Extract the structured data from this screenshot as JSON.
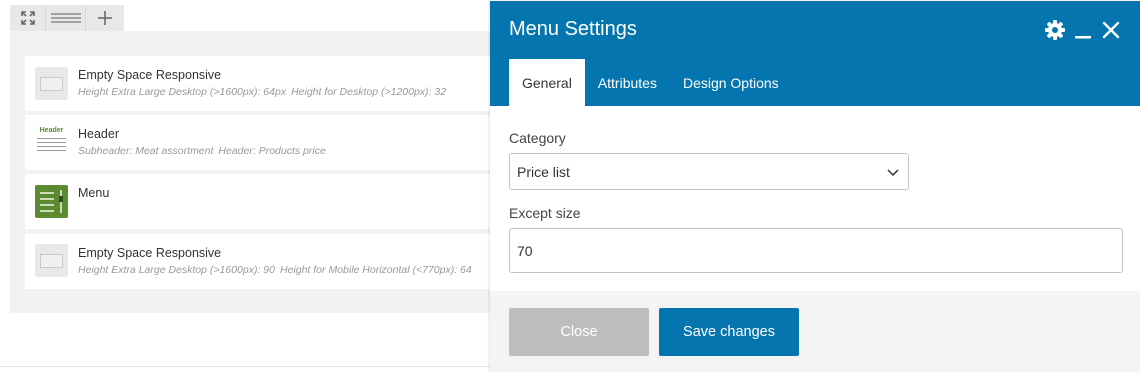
{
  "toolbar": {
    "icons": [
      "fullscreen-icon",
      "menu-lines-icon",
      "plus-icon"
    ]
  },
  "elements": [
    {
      "title": "Empty Space Responsive",
      "icon": "empty-space-icon",
      "params": [
        "Height Extra Large Desktop (>1600px): 64px",
        "Height for Desktop (>1200px): 32"
      ]
    },
    {
      "title": "Header",
      "icon": "header-icon",
      "icon_text": "Header",
      "params": [
        "Subheader: Meat assortment",
        "Header: Products price"
      ]
    },
    {
      "title": "Menu",
      "icon": "menu-element-icon",
      "params": []
    },
    {
      "title": "Empty Space Responsive",
      "icon": "empty-space-icon",
      "params": [
        "Height Extra Large Desktop (>1600px): 90",
        "Height for Mobile Horizontal (<770px): 64"
      ]
    }
  ],
  "modal": {
    "title": "Menu Settings",
    "header_icons": [
      "gear-icon",
      "minimize-icon",
      "close-icon"
    ],
    "tabs": [
      {
        "label": "General",
        "active": true
      },
      {
        "label": "Attributes",
        "active": false
      },
      {
        "label": "Design Options",
        "active": false
      }
    ],
    "fields": {
      "category": {
        "label": "Category",
        "value": "Price list"
      },
      "except_size": {
        "label": "Except size",
        "value": "70"
      }
    },
    "buttons": {
      "close_label": "Close",
      "save_label": "Save changes"
    },
    "colors": {
      "header_bg": "#0475ae",
      "save_bg": "#0475ae",
      "close_bg": "#bdbdbd",
      "menu_icon_green": "#5c8a31"
    }
  }
}
